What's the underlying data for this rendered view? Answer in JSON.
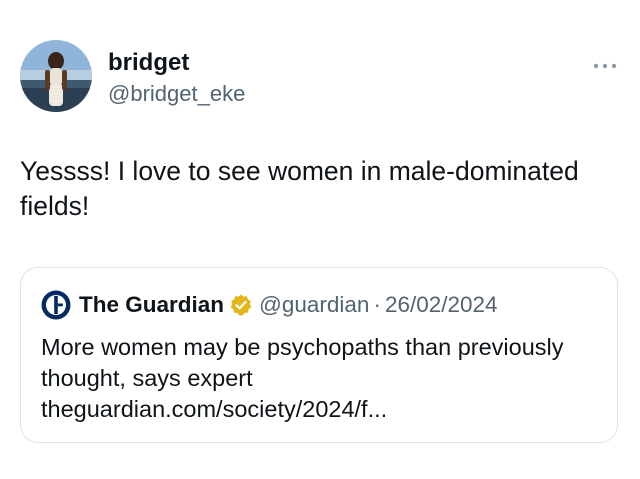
{
  "tweet": {
    "author": {
      "display_name": "bridget",
      "handle": "@bridget_eke",
      "avatar_icon": "profile-photo"
    },
    "more_icon": "ellipsis-icon",
    "text": "Yessss! I love to see women in male-dominated fields!"
  },
  "quoted_tweet": {
    "logo_icon": "guardian-logo",
    "display_name": "The Guardian",
    "verified_icon": "gold-verified-badge",
    "handle": "@guardian",
    "separator": "·",
    "date": "26/02/2024",
    "text": "More women may be psychopaths than previously thought, says expert theguardian.com/society/2024/f..."
  },
  "colors": {
    "text_primary": "#0f1419",
    "text_secondary": "#536471",
    "border": "#dfe3e7",
    "verified_gold": "#e2b719",
    "guardian_navy": "#052962"
  }
}
